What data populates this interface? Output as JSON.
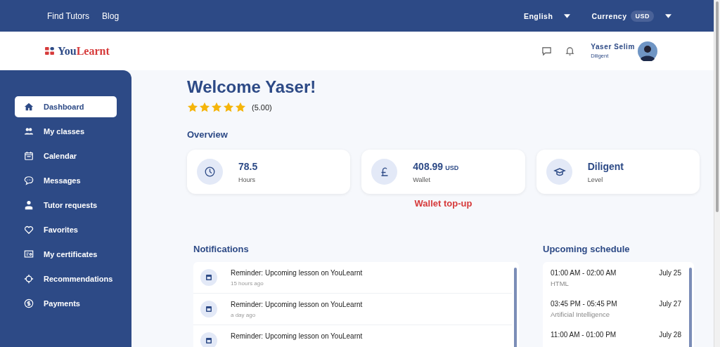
{
  "top_nav": {
    "links": [
      "Find Tutors",
      "Blog"
    ],
    "language": "English",
    "currency_label": "Currency",
    "currency": "USD"
  },
  "header": {
    "logo": {
      "part1": "You",
      "part2": "Learnt"
    },
    "user": {
      "name": "Yaser Selim",
      "level": "Diligent"
    }
  },
  "sidebar": {
    "items": [
      {
        "label": "Dashboard",
        "selected": true
      },
      {
        "label": "My classes",
        "selected": false
      },
      {
        "label": "Calendar",
        "selected": false
      },
      {
        "label": "Messages",
        "selected": false
      },
      {
        "label": "Tutor requests",
        "selected": false
      },
      {
        "label": "Favorites",
        "selected": false
      },
      {
        "label": "My certificates",
        "selected": false
      },
      {
        "label": "Recommendations",
        "selected": false
      },
      {
        "label": "Payments",
        "selected": false
      }
    ]
  },
  "welcome": {
    "title": "Welcome Yaser!",
    "stars": 5,
    "rating": "(5.00)"
  },
  "overview": {
    "title": "Overview",
    "cards": [
      {
        "value": "78.5",
        "label": "Hours"
      },
      {
        "value": "408.99",
        "unit": "USD",
        "label": "Wallet",
        "link": "Wallet top-up"
      },
      {
        "value": "Diligent",
        "label": "Level"
      }
    ]
  },
  "notifications": {
    "title": "Notifications",
    "items": [
      {
        "text": "Reminder: Upcoming lesson on YouLearnt",
        "time": "15 hours ago"
      },
      {
        "text": "Reminder: Upcoming lesson on YouLearnt",
        "time": "a day ago"
      },
      {
        "text": "Reminder: Upcoming lesson on YouLearnt"
      }
    ]
  },
  "schedule": {
    "title": "Upcoming schedule",
    "items": [
      {
        "time": "01:00 AM - 02:00 AM",
        "date": "July 25",
        "subject": "HTML"
      },
      {
        "time": "03:45 PM - 05:45 PM",
        "date": "July 27",
        "subject": "Artificial Intelligence"
      },
      {
        "time": "11:00 AM - 01:00 PM",
        "date": "July 28"
      }
    ]
  }
}
